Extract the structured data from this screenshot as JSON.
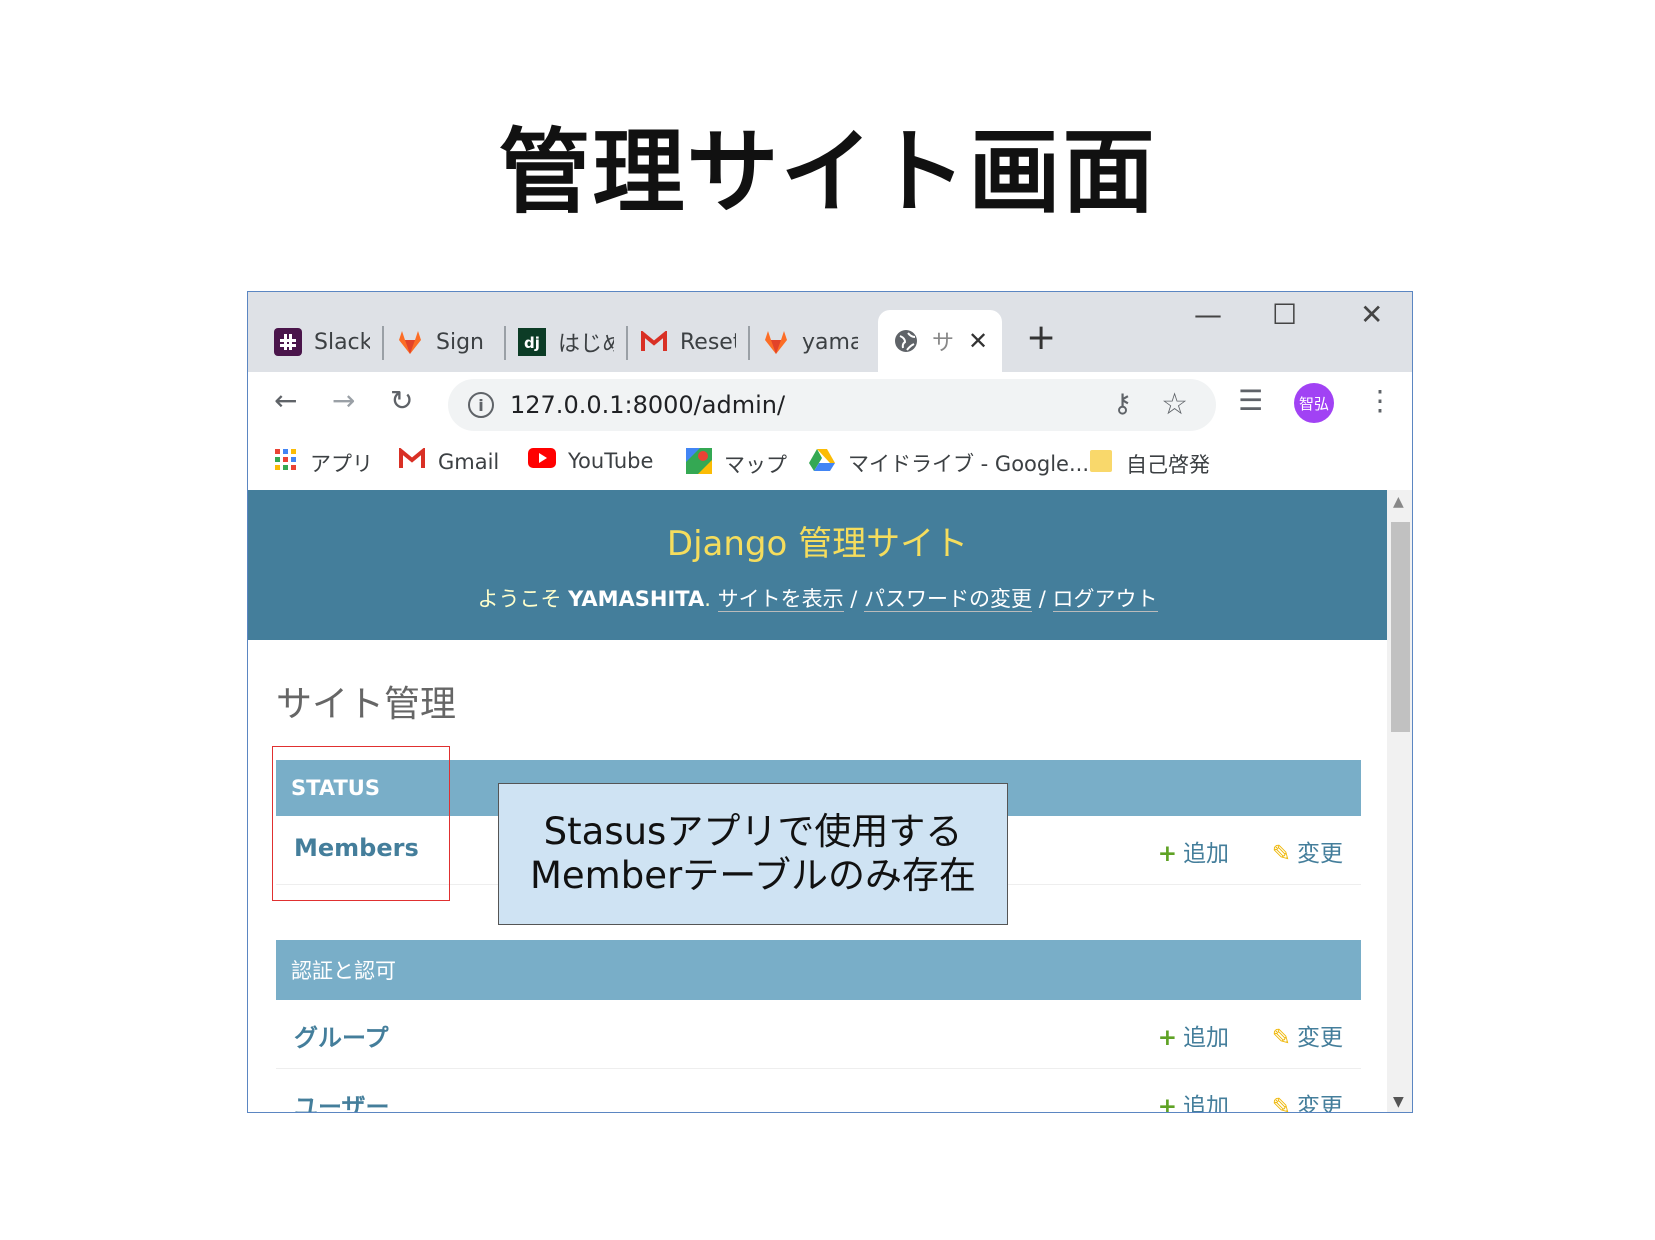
{
  "slide": {
    "title": "管理サイト画面"
  },
  "browser": {
    "tabs": [
      {
        "label": "Slack",
        "icon": "slack-icon"
      },
      {
        "label": "Sign",
        "icon": "gitlab-icon"
      },
      {
        "label": "はじめ",
        "icon": "django-icon"
      },
      {
        "label": "Reset",
        "icon": "gmail-icon"
      },
      {
        "label": "yama",
        "icon": "gitlab-icon"
      },
      {
        "label": "サ",
        "icon": "globe-icon",
        "active": true
      }
    ],
    "new_tab": "+",
    "window_controls": {
      "minimize": "—",
      "maximize": "☐",
      "close": "✕"
    },
    "url": "127.0.0.1:8000/admin/",
    "profile_initials": "智弘",
    "bookmarks": [
      {
        "label": "アプリ",
        "icon": "apps-grid-icon"
      },
      {
        "label": "Gmail",
        "icon": "gmail-icon"
      },
      {
        "label": "YouTube",
        "icon": "youtube-icon"
      },
      {
        "label": "マップ",
        "icon": "maps-icon"
      },
      {
        "label": "マイドライブ - Google...",
        "icon": "drive-icon"
      },
      {
        "label": "自己啓発",
        "icon": "folder-icon"
      }
    ]
  },
  "django": {
    "brand": "Django 管理サイト",
    "welcome": "ようこそ",
    "username": "YAMASHITA",
    "links": {
      "view_site": "サイトを表示",
      "password_change": "パスワードの変更",
      "logout": "ログアウト"
    },
    "link_sep": "/",
    "heading": "サイト管理",
    "modules": [
      {
        "caption": "STATUS",
        "rows": [
          {
            "name": "Members"
          }
        ]
      },
      {
        "caption": "認証と認可",
        "rows": [
          {
            "name": "グループ"
          },
          {
            "name": "ユーザー"
          }
        ]
      }
    ],
    "add_label": "追加",
    "change_label": "変更"
  },
  "callout": {
    "line1": "Stasusアプリで使用する",
    "line2": "Memberテーブルのみ存在"
  },
  "colors": {
    "header_bg": "#447e9b",
    "brand": "#f5dd5d",
    "module_caption": "#79aec8",
    "link": "#447e9b",
    "add": "#5fa225",
    "change": "#efb80b",
    "highlight_box": "#e03030",
    "callout_bg": "#cfe3f3"
  }
}
